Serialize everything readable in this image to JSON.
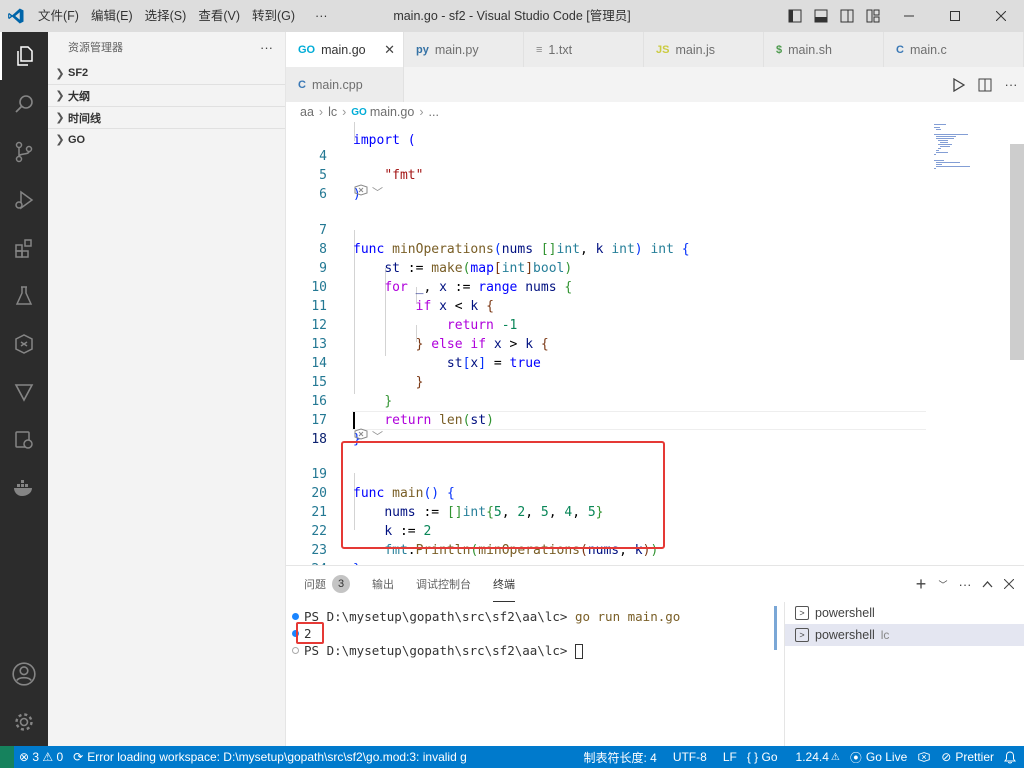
{
  "titlebar": {
    "menu": [
      "文件(F)",
      "编辑(E)",
      "选择(S)",
      "查看(V)",
      "转到(G)",
      "···"
    ],
    "title": "main.go - sf2 - Visual Studio Code [管理员]"
  },
  "sidebar": {
    "header": "资源管理器",
    "more": "···",
    "sections": [
      "SF2",
      "大纲",
      "时间线",
      "GO"
    ]
  },
  "tabs": [
    {
      "icon": "GO",
      "label": "main.go",
      "active": true,
      "icon_color": "#00acd7"
    },
    {
      "icon": "py",
      "label": "main.py",
      "active": false,
      "icon_color": "#3572a5"
    },
    {
      "icon": "≡",
      "label": "1.txt",
      "active": false,
      "icon_color": "#888888"
    },
    {
      "icon": "JS",
      "label": "main.js",
      "active": false,
      "icon_color": "#cbcb41"
    },
    {
      "icon": "$",
      "label": "main.sh",
      "active": false,
      "icon_color": "#4d9a4d"
    },
    {
      "icon": "C",
      "label": "main.c",
      "active": false,
      "icon_color": "#3a78b5"
    },
    {
      "icon": "C",
      "label": "main.cpp",
      "active": false,
      "icon_color": "#3a78b5"
    }
  ],
  "breadcrumb": {
    "items": [
      "aa",
      "lc",
      "main.go",
      "..."
    ]
  },
  "code": {
    "partial_top": "import (",
    "line_numbers": [
      "4",
      "5",
      "6",
      "7",
      "8",
      "9",
      "10",
      "11",
      "12",
      "13",
      "14",
      "15",
      "16",
      "17",
      "18",
      "19",
      "20",
      "21",
      "22",
      "23",
      "24"
    ]
  },
  "panel": {
    "tabs": [
      {
        "label": "问题",
        "badge": "3"
      },
      {
        "label": "输出"
      },
      {
        "label": "调试控制台"
      },
      {
        "label": "终端",
        "active": true
      }
    ],
    "terminal": {
      "line1_prompt": "PS D:\\mysetup\\gopath\\src\\sf2\\aa\\lc>",
      "line1_cmd": "go run main.go",
      "line2": "2",
      "line3_prompt": "PS D:\\mysetup\\gopath\\src\\sf2\\aa\\lc>"
    },
    "terminals": [
      {
        "label": "powershell",
        "sub": ""
      },
      {
        "label": "powershell",
        "sub": "lc"
      }
    ]
  },
  "statusbar": {
    "problems": "⊗ 3 ⚠ 0",
    "message": "Error loading workspace: D:\\mysetup\\gopath\\src\\sf2\\go.mod:3: invalid g",
    "indent": "制表符长度: 4",
    "encoding": "UTF-8",
    "eol": "LF",
    "language": "{ } Go",
    "go_version": "1.24.4",
    "golive": "Go Live",
    "prettier": "Prettier"
  },
  "colors": {
    "accent": "#007acc",
    "highlight_box": "#e53935"
  }
}
